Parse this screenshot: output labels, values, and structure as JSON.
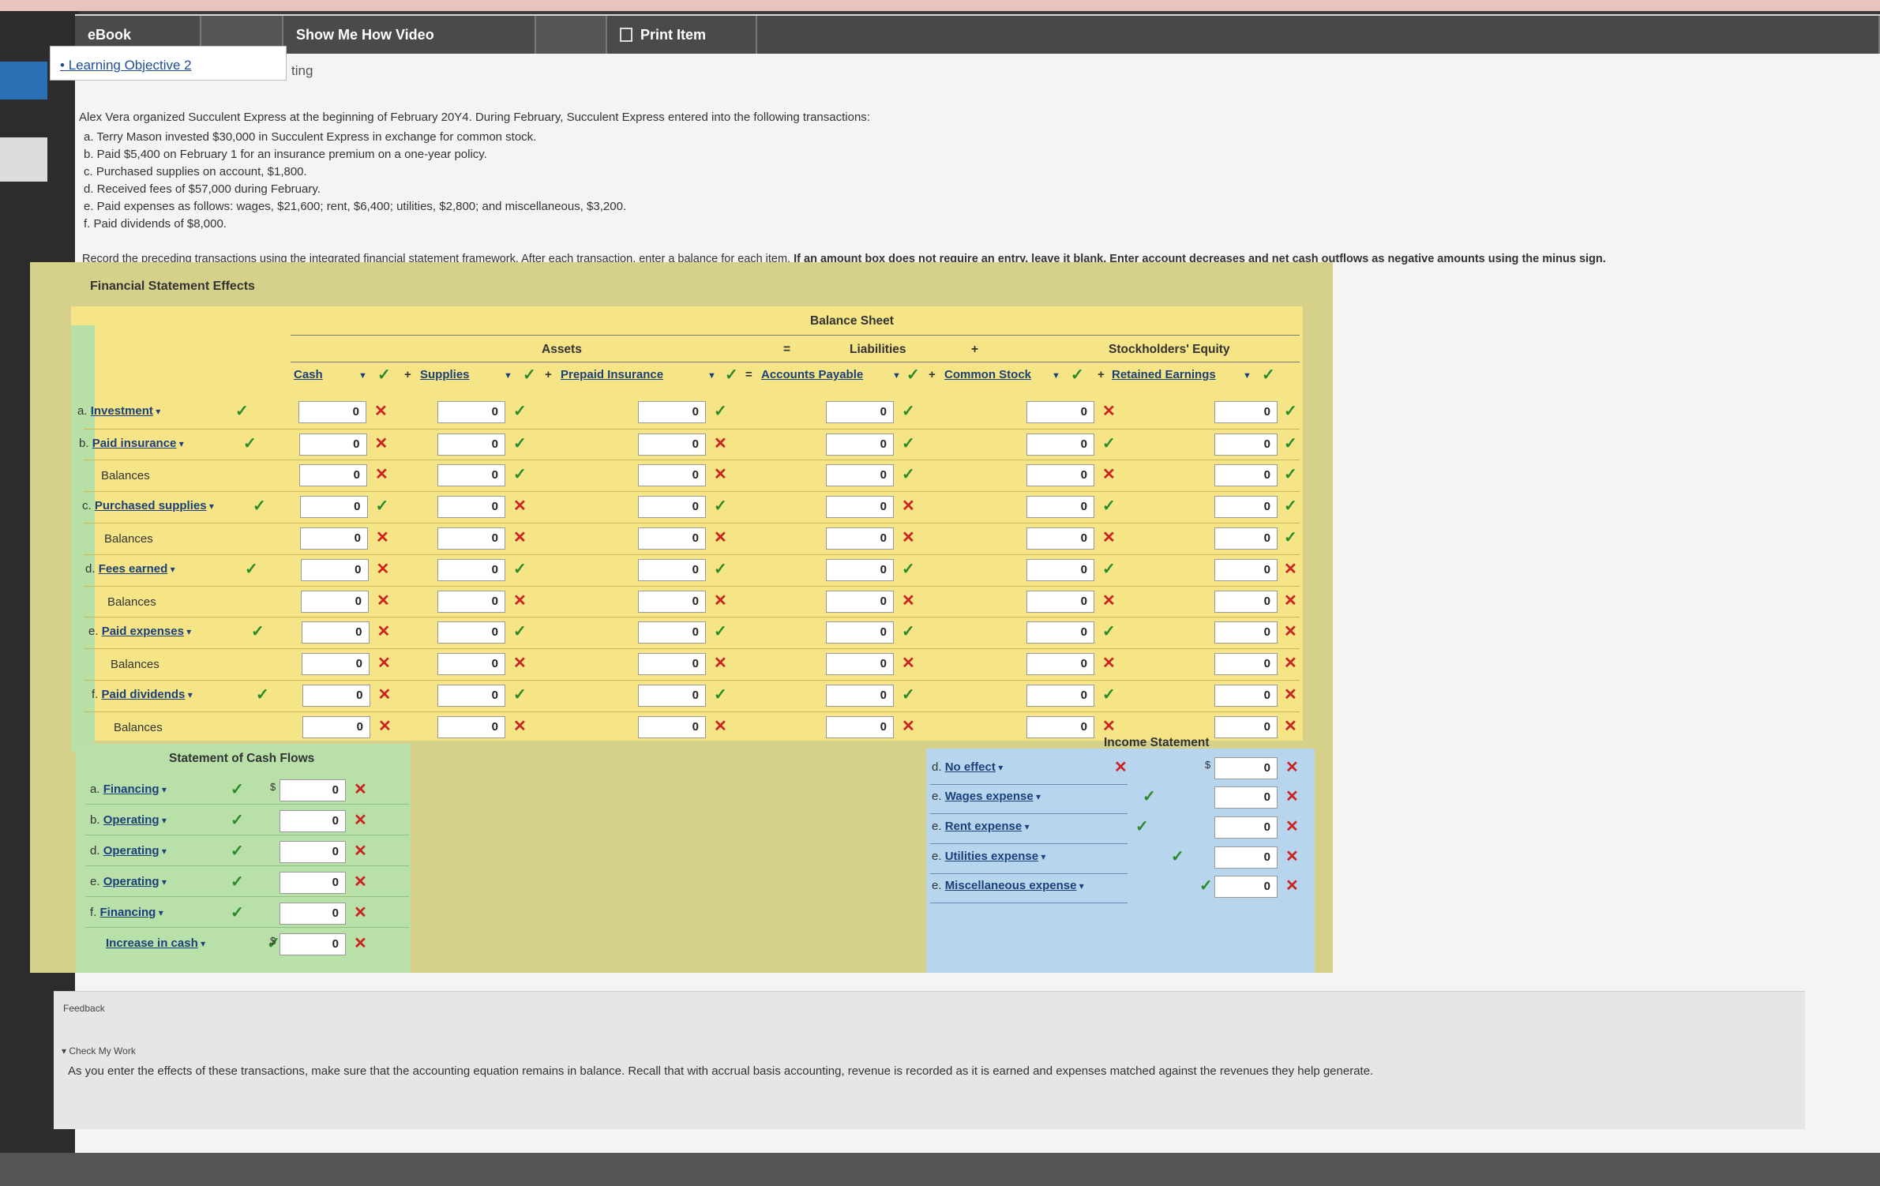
{
  "tabs": {
    "ebook": "eBook",
    "video": "Show Me How Video",
    "print": "Print Item"
  },
  "learning_objective": "Learning Objective 2",
  "partial_text": "ting",
  "problem": {
    "intro": "Alex Vera organized Succulent Express at the beginning of February 20Y4. During February, Succulent Express entered into the following transactions:",
    "transactions": [
      "a. Terry Mason invested $30,000 in Succulent Express in exchange for common stock.",
      "b. Paid $5,400 on February 1 for an insurance premium on a one-year policy.",
      "c. Purchased supplies on account, $1,800.",
      "d. Received fees of $57,000 during February.",
      "e. Paid expenses as follows: wages, $21,600; rent, $6,400; utilities, $2,800; and miscellaneous, $3,200.",
      "f. Paid dividends of $8,000."
    ],
    "instructions_plain": "Record the preceding transactions using the integrated financial statement framework. After each transaction, enter a balance for each item.",
    "instructions_bold": "If an amount box does not require an entry, leave it blank. Enter account decreases and net cash outflows as negative amounts using the minus sign."
  },
  "panel": {
    "title": "Financial Statement Effects",
    "balance_sheet": "Balance Sheet",
    "assets": "Assets",
    "liabilities": "Liabilities",
    "equity": "Stockholders' Equity",
    "equals": "=",
    "plus": "+",
    "columns": {
      "cash": "Cash",
      "supplies": "Supplies",
      "prepaid": "Prepaid Insurance",
      "ap": "Accounts Payable",
      "cs": "Common Stock",
      "re": "Retained Earnings"
    },
    "col_status": [
      "ok",
      "ok",
      "ok",
      "ok",
      "ok",
      "ok"
    ],
    "rows": [
      {
        "letter": "a.",
        "label": "Investment",
        "dropdown": true,
        "status": "ok",
        "values": [
          "0",
          "0",
          "0",
          "0",
          "0",
          "0"
        ],
        "marks": [
          "no",
          "ok",
          "ok",
          "ok",
          "no",
          "ok"
        ]
      },
      {
        "letter": "b.",
        "label": "Paid insurance",
        "dropdown": true,
        "status": "ok",
        "values": [
          "0",
          "0",
          "0",
          "0",
          "0",
          "0"
        ],
        "marks": [
          "no",
          "ok",
          "no",
          "ok",
          "ok",
          "ok"
        ]
      },
      {
        "letter": "",
        "label": "Balances",
        "dropdown": false,
        "status": "",
        "values": [
          "0",
          "0",
          "0",
          "0",
          "0",
          "0"
        ],
        "marks": [
          "no",
          "ok",
          "no",
          "ok",
          "no",
          "ok"
        ]
      },
      {
        "letter": "c.",
        "label": "Purchased supplies",
        "dropdown": true,
        "status": "ok",
        "values": [
          "0",
          "0",
          "0",
          "0",
          "0",
          "0"
        ],
        "marks": [
          "ok",
          "no",
          "ok",
          "no",
          "ok",
          "ok"
        ]
      },
      {
        "letter": "",
        "label": "Balances",
        "dropdown": false,
        "status": "",
        "values": [
          "0",
          "0",
          "0",
          "0",
          "0",
          "0"
        ],
        "marks": [
          "no",
          "no",
          "no",
          "no",
          "no",
          "ok"
        ]
      },
      {
        "letter": "d.",
        "label": "Fees earned",
        "dropdown": true,
        "status": "ok",
        "values": [
          "0",
          "0",
          "0",
          "0",
          "0",
          "0"
        ],
        "marks": [
          "no",
          "ok",
          "ok",
          "ok",
          "ok",
          "no"
        ]
      },
      {
        "letter": "",
        "label": "Balances",
        "dropdown": false,
        "status": "",
        "values": [
          "0",
          "0",
          "0",
          "0",
          "0",
          "0"
        ],
        "marks": [
          "no",
          "no",
          "no",
          "no",
          "no",
          "no"
        ]
      },
      {
        "letter": "e.",
        "label": "Paid expenses",
        "dropdown": true,
        "status": "ok",
        "values": [
          "0",
          "0",
          "0",
          "0",
          "0",
          "0"
        ],
        "marks": [
          "no",
          "ok",
          "ok",
          "ok",
          "ok",
          "no"
        ]
      },
      {
        "letter": "",
        "label": "Balances",
        "dropdown": false,
        "status": "",
        "values": [
          "0",
          "0",
          "0",
          "0",
          "0",
          "0"
        ],
        "marks": [
          "no",
          "no",
          "no",
          "no",
          "no",
          "no"
        ]
      },
      {
        "letter": "f.",
        "label": "Paid dividends",
        "dropdown": true,
        "status": "ok",
        "values": [
          "0",
          "0",
          "0",
          "0",
          "0",
          "0"
        ],
        "marks": [
          "no",
          "ok",
          "ok",
          "ok",
          "ok",
          "no"
        ]
      },
      {
        "letter": "",
        "label": "Balances",
        "dropdown": false,
        "status": "",
        "values": [
          "0",
          "0",
          "0",
          "0",
          "0",
          "0"
        ],
        "marks": [
          "no",
          "no",
          "no",
          "no",
          "no",
          "no"
        ]
      }
    ],
    "cash_flows": {
      "title": "Statement of Cash Flows",
      "rows": [
        {
          "letter": "a.",
          "label": "Financing",
          "status": "ok",
          "value": "0",
          "mark": "no",
          "dollar": "$"
        },
        {
          "letter": "b.",
          "label": "Operating",
          "status": "ok",
          "value": "0",
          "mark": "no",
          "dollar": ""
        },
        {
          "letter": "d.",
          "label": "Operating",
          "status": "ok",
          "value": "0",
          "mark": "no",
          "dollar": ""
        },
        {
          "letter": "e.",
          "label": "Operating",
          "status": "ok",
          "value": "0",
          "mark": "no",
          "dollar": ""
        },
        {
          "letter": "f.",
          "label": "Financing",
          "status": "ok",
          "value": "0",
          "mark": "no",
          "dollar": ""
        },
        {
          "letter": "",
          "label": "Increase in cash",
          "status": "ok",
          "value": "0",
          "mark": "no",
          "dollar": "$"
        }
      ]
    },
    "income_statement": {
      "title": "Income Statement",
      "rows": [
        {
          "letter": "d.",
          "label": "No effect",
          "status": "no",
          "value": "0",
          "mark": "no",
          "dollar": "$"
        },
        {
          "letter": "e.",
          "label": "Wages expense",
          "status": "ok",
          "value": "0",
          "mark": "no",
          "dollar": ""
        },
        {
          "letter": "e.",
          "label": "Rent expense",
          "status": "ok",
          "value": "0",
          "mark": "no",
          "dollar": ""
        },
        {
          "letter": "e.",
          "label": "Utilities expense",
          "status": "ok",
          "value": "0",
          "mark": "no",
          "dollar": ""
        },
        {
          "letter": "e.",
          "label": "Miscellaneous expense",
          "status": "ok",
          "value": "0",
          "mark": "no",
          "dollar": ""
        }
      ]
    }
  },
  "feedback": {
    "title": "Feedback",
    "check": "Check My Work",
    "text": "As you enter the effects of these transactions, make sure that the accounting equation remains in balance. Recall that with accrual basis accounting, revenue is recorded as it is earned and expenses matched against the revenues they help generate."
  },
  "icons": {
    "check": "check-icon",
    "cross": "cross-icon",
    "dropdown": "chevron-down-icon",
    "back": "back-arrow-icon",
    "print": "print-icon"
  },
  "colors": {
    "correct": "#2a8a2a",
    "incorrect": "#cc2222",
    "link": "#1b3f7a",
    "balance_sheet_bg": "#f5e586",
    "cash_flow_bg": "#b9e0a8",
    "income_bg": "#b7d6ee"
  }
}
